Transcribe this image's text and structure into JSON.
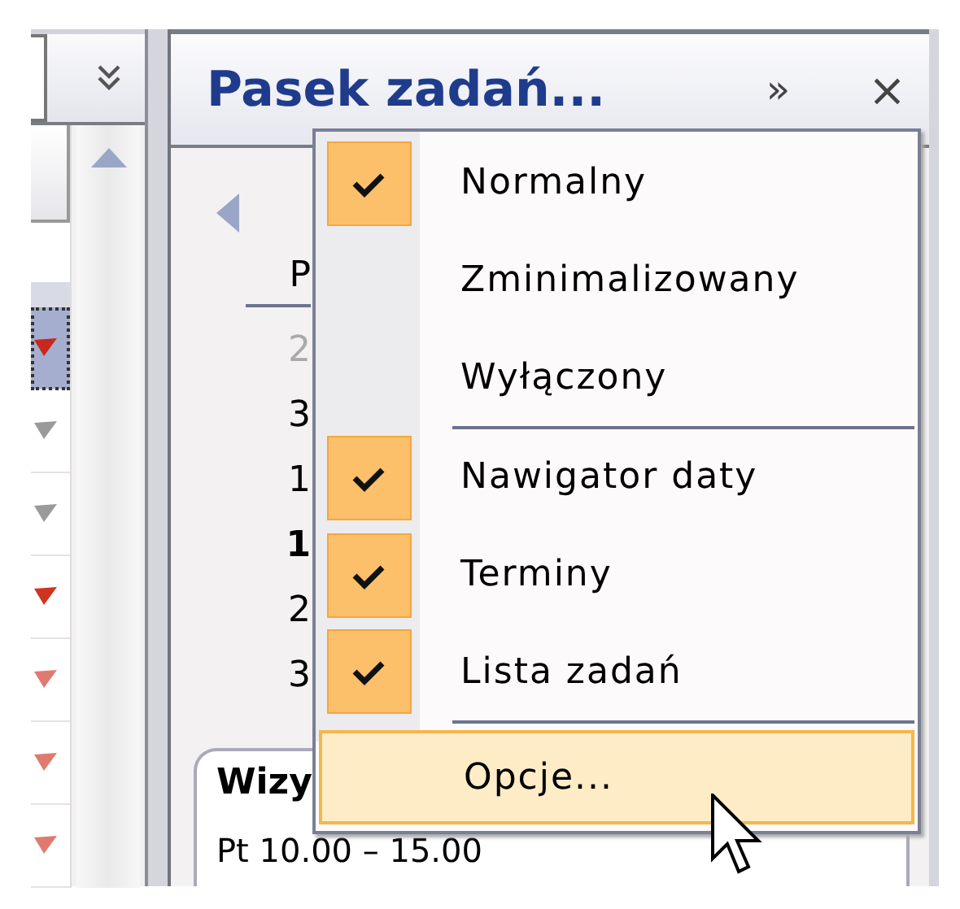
{
  "left_pane": {
    "rows": [
      {
        "color": "#c8281e",
        "selected": true
      },
      {
        "color": "#9a9a9a",
        "selected": false
      },
      {
        "color": "#9a9a9a",
        "selected": false
      },
      {
        "color": "#d0341e",
        "selected": false
      },
      {
        "color": "#e07a70",
        "selected": false
      },
      {
        "color": "#e07a70",
        "selected": false
      },
      {
        "color": "#e07a70",
        "selected": false
      }
    ]
  },
  "todo_bar": {
    "title": "Pasek zadań...",
    "expand": "»",
    "close": "×",
    "calendar": {
      "day_header": "P",
      "days": [
        {
          "text": "2",
          "other_month": true,
          "today": false
        },
        {
          "text": "3",
          "other_month": false,
          "today": false
        },
        {
          "text": "1",
          "other_month": false,
          "today": false
        },
        {
          "text": "1",
          "other_month": false,
          "today": true
        },
        {
          "text": "2",
          "other_month": false,
          "today": false
        },
        {
          "text": "3",
          "other_month": false,
          "today": false
        }
      ]
    },
    "appointment": {
      "title": "Wizy",
      "time": "Pt 10.00 – 15.00"
    }
  },
  "menu": {
    "items": [
      {
        "kind": "item",
        "label": "Normalny",
        "checked": true,
        "highlighted": false
      },
      {
        "kind": "item",
        "label": "Zminimalizowany",
        "checked": false,
        "highlighted": false
      },
      {
        "kind": "item",
        "label": "Wyłączony",
        "checked": false,
        "highlighted": false
      },
      {
        "kind": "separator"
      },
      {
        "kind": "item",
        "label": "Nawigator daty",
        "checked": true,
        "highlighted": false
      },
      {
        "kind": "item",
        "label": "Terminy",
        "checked": true,
        "highlighted": false
      },
      {
        "kind": "item",
        "label": "Lista zadań",
        "checked": true,
        "highlighted": false
      },
      {
        "kind": "separator"
      },
      {
        "kind": "option",
        "label": "Opcje...",
        "checked": false,
        "highlighted": true
      }
    ]
  }
}
